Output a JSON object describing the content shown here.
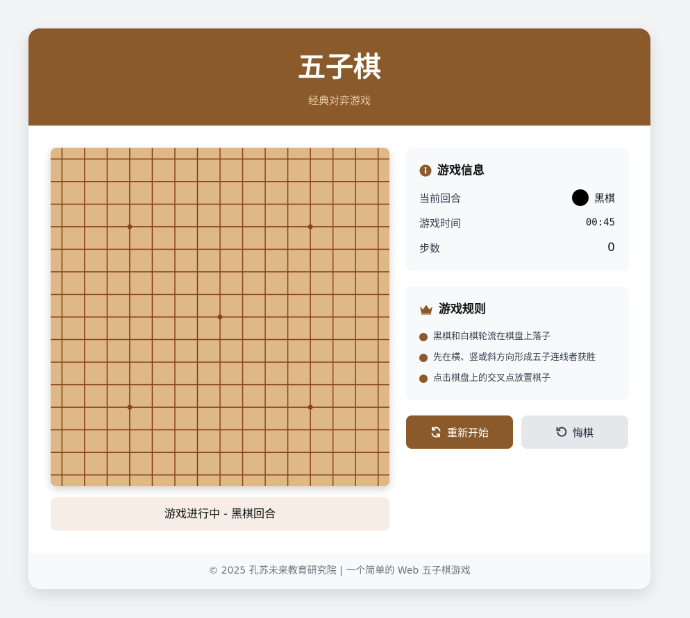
{
  "header": {
    "title": "五子棋",
    "subtitle": "经典对弈游戏"
  },
  "board": {
    "size": 15,
    "colors": {
      "background": "#deb887",
      "line": "#8b4513",
      "star_point": "#8b4513"
    },
    "star_points": [
      [
        3,
        3
      ],
      [
        3,
        11
      ],
      [
        7,
        7
      ],
      [
        11,
        3
      ],
      [
        11,
        11
      ]
    ],
    "stones": []
  },
  "status": {
    "text": "游戏进行中 - 黑棋回合"
  },
  "info": {
    "title": "游戏信息",
    "icon": "info-circle-icon",
    "current_turn_label": "当前回合",
    "current_turn_value": "黑棋",
    "time_label": "游戏时间",
    "time_value": "00:45",
    "steps_label": "步数",
    "steps_value": "0"
  },
  "rules": {
    "title": "游戏规则",
    "icon": "crown-icon",
    "items": [
      "黑棋和白棋轮流在棋盘上落子",
      "先在横、竖或斜方向形成五子连线者获胜",
      "点击棋盘上的交叉点放置棋子"
    ]
  },
  "buttons": {
    "restart_label": "重新开始",
    "restart_icon": "refresh-icon",
    "undo_label": "悔棋",
    "undo_icon": "undo-icon"
  },
  "footer": {
    "text": "© 2025 孔苏未来教育研究院 | 一个简单的 Web 五子棋游戏"
  },
  "theme": {
    "accent": "#8b5a2b",
    "page_bg": "#f3f4f6"
  }
}
